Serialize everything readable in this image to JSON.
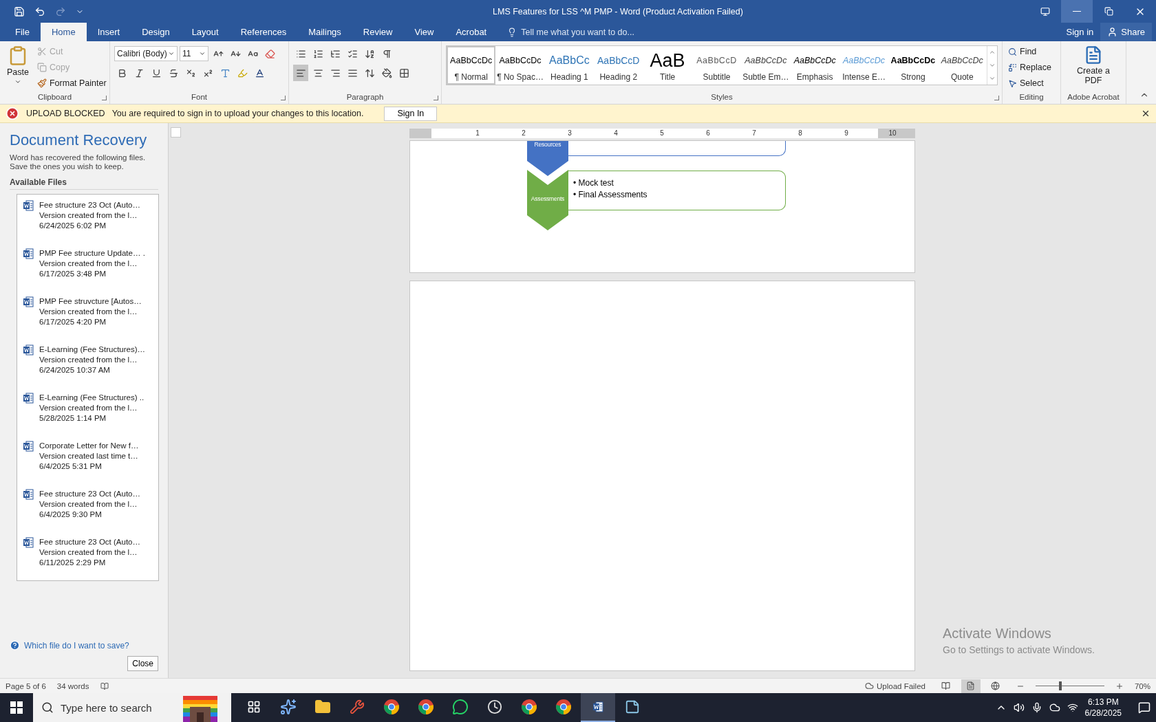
{
  "window": {
    "title": "LMS Features for LSS ^M PMP - Word (Product Activation Failed)"
  },
  "tabs": [
    {
      "label": "File",
      "selected": false
    },
    {
      "label": "Home",
      "selected": true
    },
    {
      "label": "Insert",
      "selected": false
    },
    {
      "label": "Design",
      "selected": false
    },
    {
      "label": "Layout",
      "selected": false
    },
    {
      "label": "References",
      "selected": false
    },
    {
      "label": "Mailings",
      "selected": false
    },
    {
      "label": "Review",
      "selected": false
    },
    {
      "label": "View",
      "selected": false
    },
    {
      "label": "Acrobat",
      "selected": false
    }
  ],
  "tell_me": {
    "placeholder": "Tell me what you want to do..."
  },
  "account": {
    "sign_in": "Sign in",
    "share": "Share"
  },
  "clipboard": {
    "label": "Clipboard",
    "paste": "Paste",
    "commands": [
      {
        "label": "Cut",
        "disabled": true
      },
      {
        "label": "Copy",
        "disabled": true
      },
      {
        "label": "Format Painter",
        "disabled": false
      }
    ]
  },
  "font": {
    "label": "Font",
    "font_name": "Calibri (Body)",
    "font_size": "11"
  },
  "paragraph": {
    "label": "Paragraph"
  },
  "styles": {
    "label": "Styles",
    "items": [
      {
        "kind": "normal",
        "preview": "AaBbCcDc",
        "label": "¶ Normal",
        "selected": true
      },
      {
        "kind": "normal",
        "preview": "AaBbCcDc",
        "label": "¶ No Spac…",
        "selected": false
      },
      {
        "kind": "heading1",
        "preview": "AaBbCc",
        "label": "Heading 1",
        "selected": false
      },
      {
        "kind": "heading2",
        "preview": "AaBbCcD",
        "label": "Heading 2",
        "selected": false
      },
      {
        "kind": "title",
        "preview": "AaB",
        "label": "Title",
        "selected": false
      },
      {
        "kind": "subtitle",
        "preview": "AaBbCcD",
        "label": "Subtitle",
        "selected": false
      },
      {
        "kind": "subtle",
        "preview": "AaBbCcDc",
        "label": "Subtle Em…",
        "selected": false
      },
      {
        "kind": "emphasis",
        "preview": "AaBbCcDc",
        "label": "Emphasis",
        "selected": false
      },
      {
        "kind": "intense",
        "preview": "AaBbCcDc",
        "label": "Intense E…",
        "selected": false
      },
      {
        "kind": "strong",
        "preview": "AaBbCcDc",
        "label": "Strong",
        "selected": false
      },
      {
        "kind": "quote",
        "preview": "AaBbCcDc",
        "label": "Quote",
        "selected": false
      }
    ]
  },
  "editing": {
    "label": "Editing",
    "commands": [
      {
        "kind": "find",
        "label": "Find"
      },
      {
        "kind": "replace",
        "label": "Replace"
      },
      {
        "kind": "select",
        "label": "Select"
      }
    ]
  },
  "acrobat": {
    "label": "Adobe Acrobat",
    "command": "Create a PDF"
  },
  "message_bar": {
    "title": "UPLOAD BLOCKED",
    "text": "You are required to sign in to upload your changes to this location.",
    "button": "Sign In"
  },
  "recovery": {
    "title": "Document Recovery",
    "description": "Word has recovered the following files. Save the ones you wish to keep.",
    "section": "Available Files",
    "files": [
      {
        "name": "Fee structure 23 Oct (Auto…",
        "detail": "Version created from the l…",
        "date": "6/24/2025 6:02 PM"
      },
      {
        "name": "PMP Fee structure Update… .",
        "detail": "Version created from the l…",
        "date": "6/17/2025 3:48 PM"
      },
      {
        "name": "PMP Fee struvcture  [Autos…",
        "detail": "Version created from the l…",
        "date": "6/17/2025 4:20 PM"
      },
      {
        "name": "E-Learning (Fee Structures)…",
        "detail": "Version created from the l…",
        "date": "6/24/2025 10:37 AM"
      },
      {
        "name": "E-Learning (Fee Structures) ..",
        "detail": "Version created from the l…",
        "date": "5/28/2025 1:14 PM"
      },
      {
        "name": "Corporate Letter for New f…",
        "detail": "Version created last time t…",
        "date": "6/4/2025 5:31 PM"
      },
      {
        "name": "Fee structure 23 Oct (Auto…",
        "detail": "Version created from the l…",
        "date": "6/4/2025 9:30 PM"
      },
      {
        "name": "Fee structure 23 Oct (Auto…",
        "detail": "Version created from the l…",
        "date": "6/11/2025 2:29 PM"
      }
    ],
    "help_link": "Which file do I want to save?",
    "close": "Close"
  },
  "ruler": {
    "marks": [
      "1",
      "2",
      "3",
      "4",
      "5",
      "6",
      "7",
      "8",
      "9",
      "10"
    ]
  },
  "diagram": [
    {
      "label": "Resources",
      "color": "#4472c4"
    },
    {
      "label": "Assessments",
      "color": "#70ad47",
      "bullets": [
        "• Mock test",
        "• Final Assessments"
      ]
    }
  ],
  "activation": {
    "title": "Activate Windows",
    "text": "Go to Settings to activate Windows."
  },
  "status_bar": {
    "page": "Page 5 of 6",
    "words": "34 words",
    "upload": "Upload Failed",
    "views": [
      {
        "kind": "read",
        "selected": false
      },
      {
        "kind": "print",
        "selected": true
      },
      {
        "kind": "web",
        "selected": false
      }
    ],
    "zoom": {
      "level": 0.36,
      "reading": "70%"
    }
  },
  "taskbar": {
    "search": {
      "placeholder": "Type here to search"
    },
    "apps": [
      {
        "kind": "copilot",
        "selected": false
      },
      {
        "kind": "folder",
        "selected": false
      },
      {
        "kind": "tool",
        "selected": false
      },
      {
        "kind": "chrome",
        "selected": false
      },
      {
        "kind": "chrome",
        "selected": false
      },
      {
        "kind": "chat",
        "selected": false
      },
      {
        "kind": "clock",
        "selected": false
      },
      {
        "kind": "chrome",
        "selected": false
      },
      {
        "kind": "chrome",
        "selected": false
      },
      {
        "kind": "word",
        "selected": true
      },
      {
        "kind": "notes",
        "selected": false
      }
    ],
    "time": "6:13 PM",
    "date": "6/28/2025"
  }
}
